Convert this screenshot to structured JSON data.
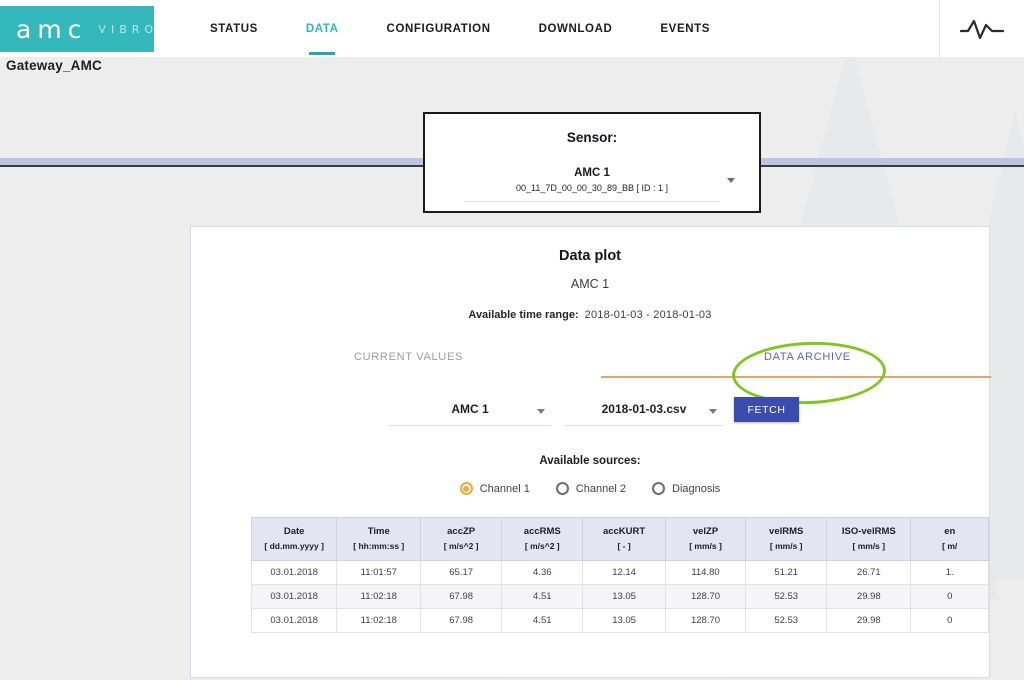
{
  "header": {
    "logo_main": "amc",
    "logo_sub": "VIBRO",
    "nav": [
      {
        "label": "STATUS",
        "active": false
      },
      {
        "label": "DATA",
        "active": true
      },
      {
        "label": "CONFIGURATION",
        "active": false
      },
      {
        "label": "DOWNLOAD",
        "active": false
      },
      {
        "label": "EVENTS",
        "active": false
      }
    ],
    "right_icon": "waveform-pulse-icon",
    "gateway_label": "Gateway_AMC"
  },
  "sensor_panel": {
    "title": "Sensor:",
    "selected_name": "AMC 1",
    "selected_mac": "00_11_7D_00_00_30_89_BB [ ID : 1 ]"
  },
  "data_plot": {
    "title": "Data plot",
    "subtitle": "AMC 1",
    "time_range_label": "Available time range:",
    "time_range_value": "2018-01-03  -  2018-01-03",
    "tabs": [
      {
        "label": "CURRENT VALUES",
        "active": false
      },
      {
        "label": "DATA ARCHIVE",
        "active": true
      }
    ],
    "highlight_color": "#81c520",
    "underline_color": "#e0a56a",
    "controls": {
      "sensor_select_value": "AMC 1",
      "file_select_value": "2018-01-03.csv",
      "fetch_label": "FETCH",
      "fetch_color": "#3b4cae"
    },
    "sources_label": "Available sources:",
    "sources": [
      {
        "label": "Channel 1",
        "selected": true
      },
      {
        "label": "Channel 2",
        "selected": false
      },
      {
        "label": "Diagnosis",
        "selected": false
      }
    ],
    "accent_radio_color": "#f2a93b"
  },
  "table": {
    "columns": [
      {
        "name": "Date",
        "unit": "[ dd.mm.yyyy ]"
      },
      {
        "name": "Time",
        "unit": "[ hh:mm:ss ]"
      },
      {
        "name": "accZP",
        "unit": "[ m/s^2 ]"
      },
      {
        "name": "accRMS",
        "unit": "[ m/s^2 ]"
      },
      {
        "name": "accKURT",
        "unit": "[ - ]"
      },
      {
        "name": "velZP",
        "unit": "[ mm/s ]"
      },
      {
        "name": "velRMS",
        "unit": "[ mm/s ]"
      },
      {
        "name": "ISO-velRMS",
        "unit": "[ mm/s ]"
      },
      {
        "name": "en",
        "unit": "[ m/"
      }
    ],
    "rows": [
      [
        "03.01.2018",
        "11:01:57",
        "65.17",
        "4.36",
        "12.14",
        "114.80",
        "51.21",
        "26.71",
        "1."
      ],
      [
        "03.01.2018",
        "11:02:18",
        "67.98",
        "4.51",
        "13.05",
        "128.70",
        "52.53",
        "29.98",
        "0"
      ],
      [
        "03.01.2018",
        "11:02:18",
        "67.98",
        "4.51",
        "13.05",
        "128.70",
        "52.53",
        "29.98",
        "0"
      ]
    ]
  }
}
